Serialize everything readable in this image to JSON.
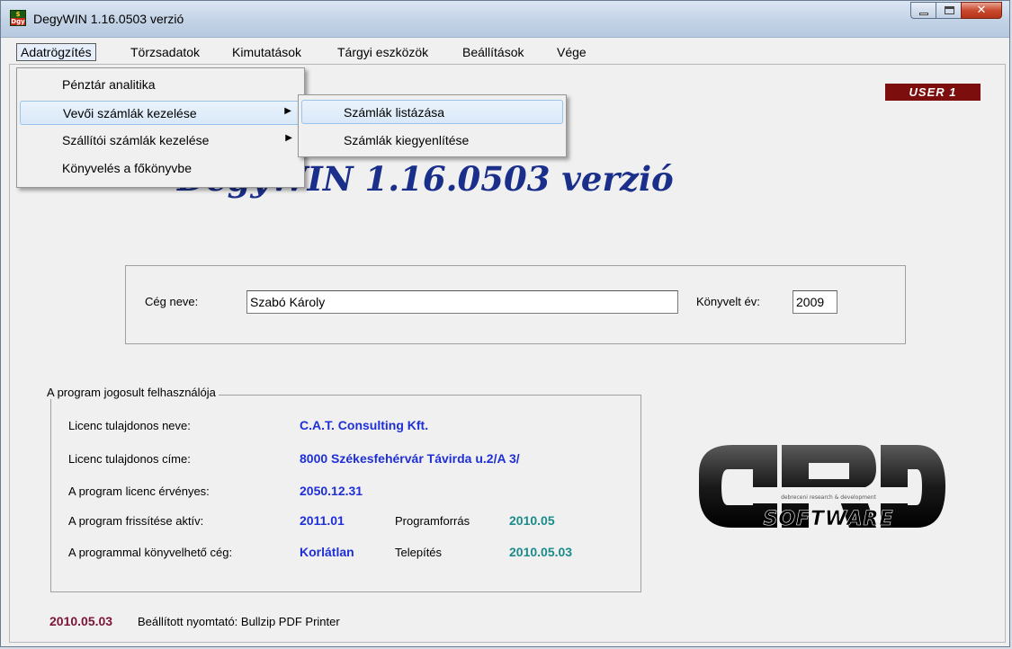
{
  "window": {
    "title": "DegyWIN 1.16.0503 verzió"
  },
  "menubar": [
    {
      "label": "Adatrögzítés",
      "active": true
    },
    {
      "label": "Törzsadatok"
    },
    {
      "label": "Kimutatások"
    },
    {
      "label": "Tárgyi eszközök"
    },
    {
      "label": "Beállítások"
    },
    {
      "label": "Vége"
    }
  ],
  "dropdown": {
    "items": [
      {
        "label": "Pénztár analitika"
      },
      {
        "label": "Vevői számlák kezelése",
        "submenu": true,
        "highlighted": true
      },
      {
        "label": "Szállítói számlák kezelése",
        "submenu": true
      },
      {
        "label": "Könyvelés a főkönyvbe"
      }
    ]
  },
  "submenu": {
    "items": [
      {
        "label": "Számlák listázása",
        "highlighted": true
      },
      {
        "label": "Számlák kiegyenlítése"
      }
    ]
  },
  "user_badge": "USER 1",
  "big_title": "DegyWIN 1.16.0503 verzió",
  "company": {
    "name_label": "Cég neve:",
    "name_value": "Szabó Károly",
    "year_label": "Könyvelt év:",
    "year_value": "2009"
  },
  "license": {
    "group_title": "A program jogosult felhasználója",
    "owner_name_label": "Licenc tulajdonos neve:",
    "owner_name_value": "C.A.T. Consulting Kft.",
    "owner_address_label": "Licenc tulajdonos címe:",
    "owner_address_value": "8000 Székesfehérvár Távirda u.2/A 3/",
    "valid_label": "A program licenc érvényes:",
    "valid_value": "2050.12.31",
    "update_label": "A program frissítése aktív:",
    "update_value": "2011.01",
    "source_label": "Programforrás",
    "source_value": "2010.05",
    "companies_label": "A programmal könyvelhető cég:",
    "companies_value": "Korlátlan",
    "install_label": "Telepítés",
    "install_value": "2010.05.03"
  },
  "footer": {
    "date": "2010.05.03",
    "printer_text": "Beállított nyomtató: Bullzip PDF Printer"
  },
  "logo": {
    "text": "SOFTWARE",
    "tagline": "debreceni research & development"
  },
  "colors": {
    "title_blue": "#1a2f8a",
    "value_blue": "#1f2fd6",
    "value_teal": "#1b8a8a",
    "badge_red": "#7d0e0e",
    "footer_date": "#7a1438"
  }
}
